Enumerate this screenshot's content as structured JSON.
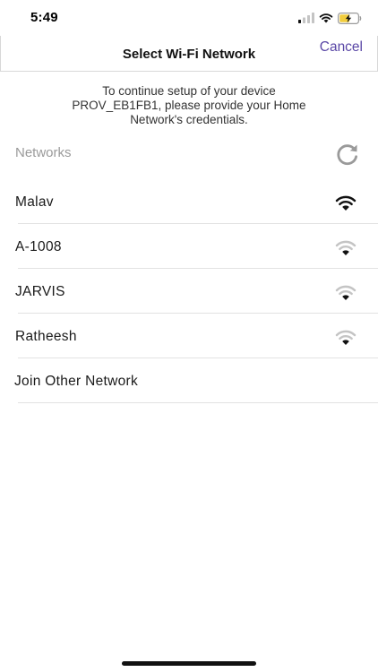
{
  "status_bar": {
    "time": "5:49"
  },
  "header": {
    "title": "Select Wi-Fi Network",
    "cancel_label": "Cancel"
  },
  "instructions": {
    "lines": [
      "To continue setup of your device",
      "PROV_EB1FB1, please provide your Home",
      "Network's credentials."
    ]
  },
  "networks": {
    "label": "Networks",
    "items": [
      {
        "name": "Malav",
        "signal": "strong",
        "icon": "wifi-icon"
      },
      {
        "name": "A-1008",
        "signal": "weak",
        "icon": "wifi-icon"
      },
      {
        "name": "JARVIS",
        "signal": "weak",
        "icon": "wifi-icon"
      },
      {
        "name": "Ratheesh",
        "signal": "weak",
        "icon": "wifi-icon"
      }
    ],
    "join_other_label": "Join Other Network"
  },
  "colors": {
    "accent": "#5a47a6",
    "wifi_strong": "#111111",
    "wifi_weak": "#c4c4c4",
    "label_gray": "#9a9a9a",
    "battery_fill": "#f2cd3d"
  }
}
